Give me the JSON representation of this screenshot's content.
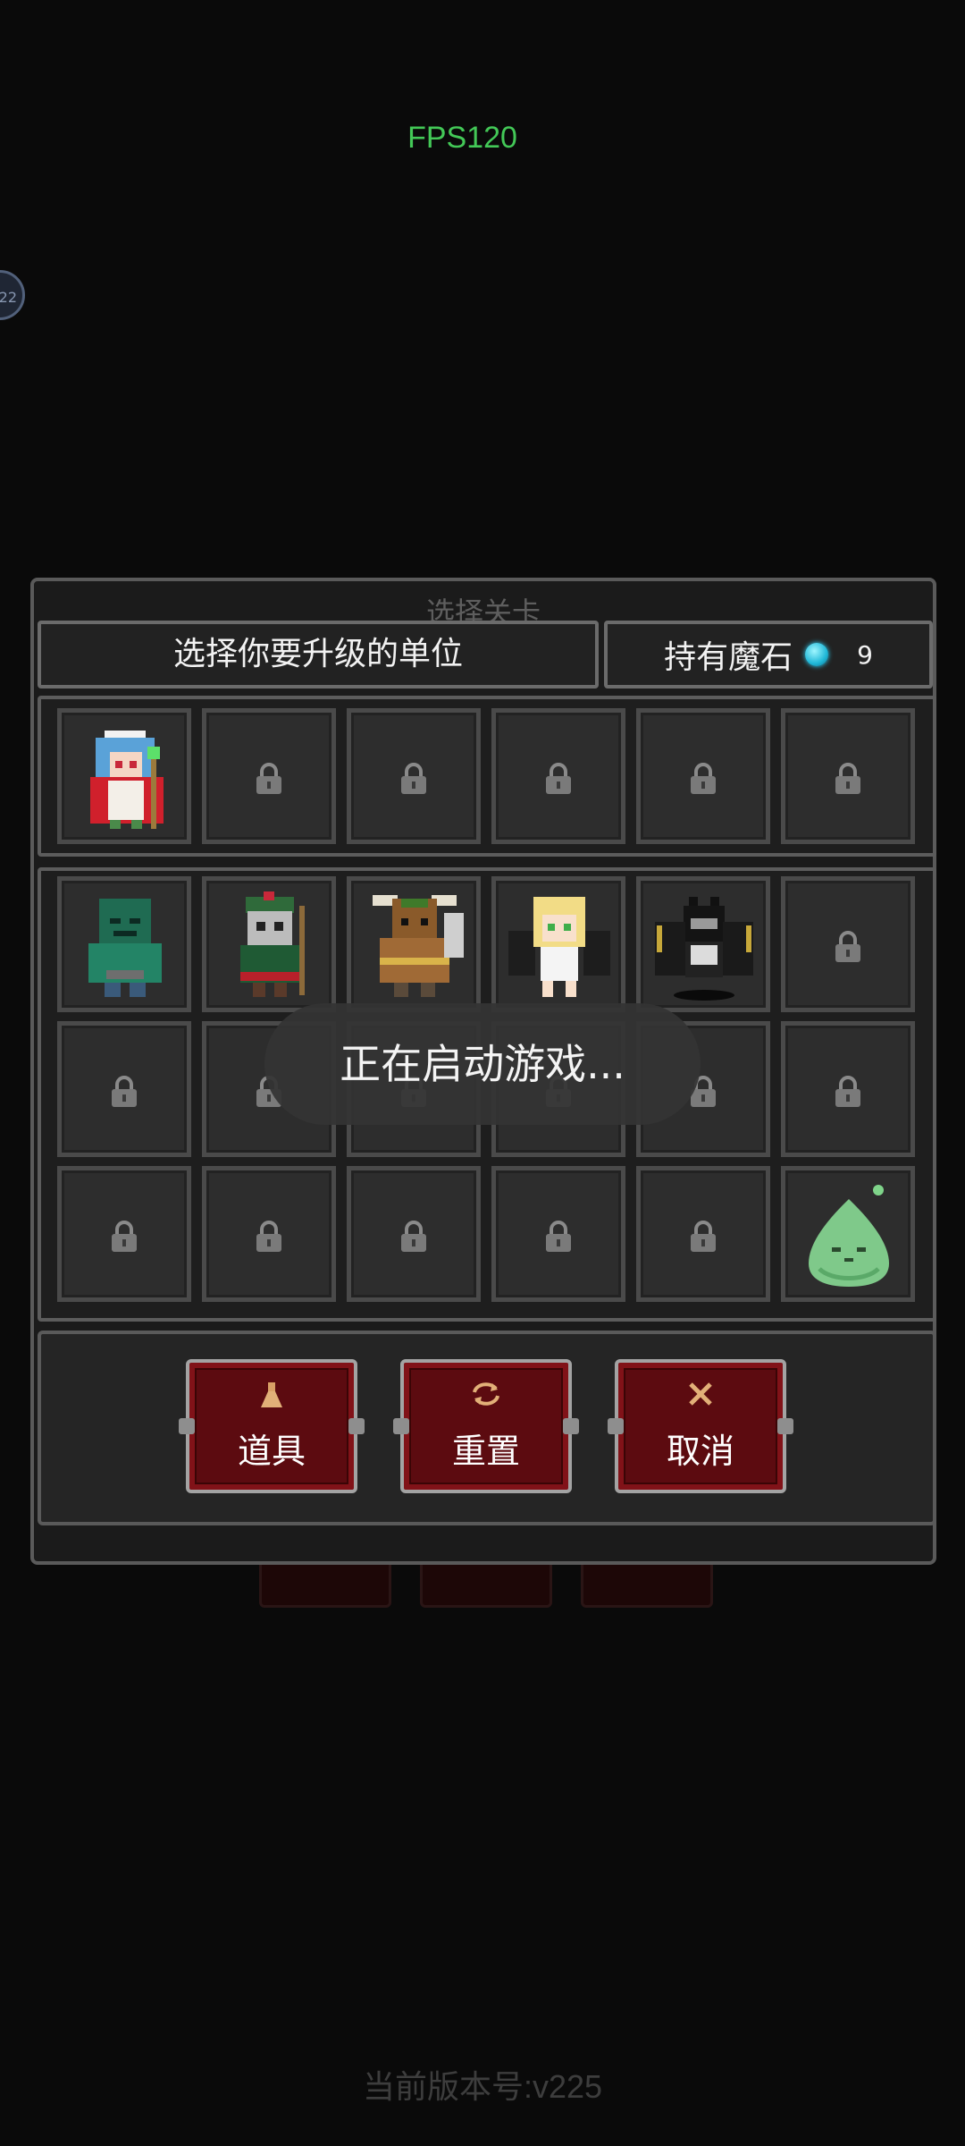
{
  "status": {
    "fps": "FPS120",
    "edge_badge": "22"
  },
  "background": {
    "ghost_title": "选择关卡",
    "version": "当前版本号:v225"
  },
  "dialog": {
    "title": "选择关卡",
    "header_left": "选择你要升级的单位",
    "header_right_label": "持有魔石",
    "gem_count": "9"
  },
  "toast": "正在启动游戏...",
  "buttons": {
    "items": {
      "label": "道具",
      "icon": "potion-icon"
    },
    "reset": {
      "label": "重置",
      "icon": "refresh-icon"
    },
    "cancel": {
      "label": "取消",
      "icon": "close-icon"
    }
  },
  "grids": {
    "top_row": [
      "princess-mage",
      "locked",
      "locked",
      "locked",
      "locked",
      "locked"
    ],
    "bottom_rows": [
      [
        "green-zombie",
        "masked-shaman",
        "minotaur-warrior",
        "blonde-angel",
        "dark-bat",
        "locked"
      ],
      [
        "locked",
        "locked",
        "locked",
        "locked",
        "locked",
        "locked"
      ],
      [
        "locked",
        "locked",
        "locked",
        "locked",
        "locked",
        "green-slime"
      ]
    ]
  },
  "colors": {
    "fps_green": "#43c857",
    "button_red": "#5c0b10",
    "gem_cyan": "#20b8d8"
  }
}
